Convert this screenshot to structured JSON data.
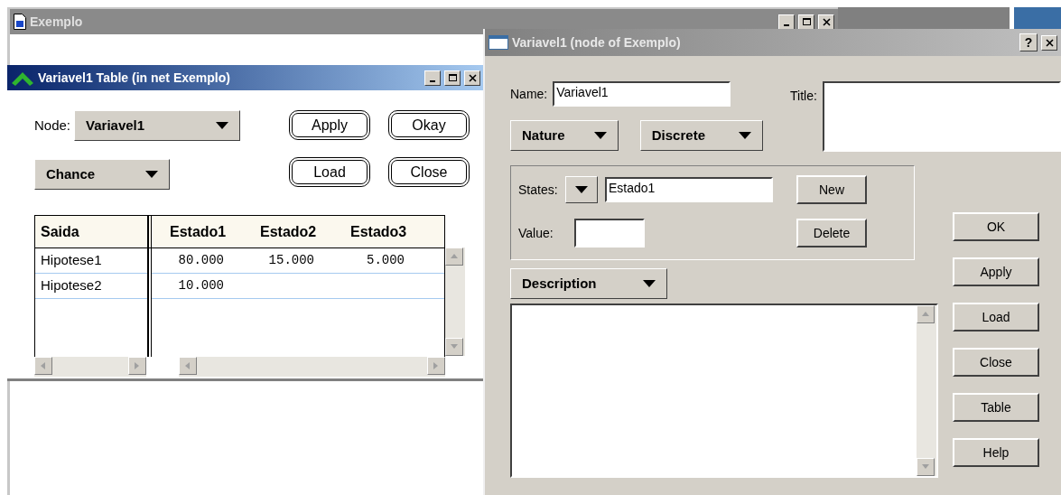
{
  "main_window": {
    "title": "Exemplo"
  },
  "table_window": {
    "title": "Variavel1 Table (in net Exemplo)",
    "node_label": "Node:",
    "node_value": "Variavel1",
    "kind_value": "Chance",
    "buttons": [
      "Apply",
      "Okay",
      "Load",
      "Close"
    ],
    "table": {
      "row_header": "Saida",
      "columns": [
        "Estado1",
        "Estado2",
        "Estado3"
      ],
      "rows": [
        {
          "label": "Hipotese1",
          "cells": [
            "80.000",
            "15.000",
            "5.000"
          ]
        },
        {
          "label": "Hipotese2",
          "cells": [
            "10.000"
          ]
        }
      ]
    }
  },
  "node_dialog": {
    "title": "Variavel1 (node of Exemplo)",
    "help_button": "?",
    "name_label": "Name:",
    "name_value": "Variavel1",
    "title_label": "Title:",
    "dropdowns": [
      "Nature",
      "Discrete"
    ],
    "states_label": "States:",
    "state_value": "Estado1",
    "new_button": "New",
    "value_label": "Value:",
    "delete_button": "Delete",
    "description_dropdown": "Description",
    "side_buttons": [
      "OK",
      "Apply",
      "Load",
      "Close",
      "Table",
      "Help"
    ]
  }
}
